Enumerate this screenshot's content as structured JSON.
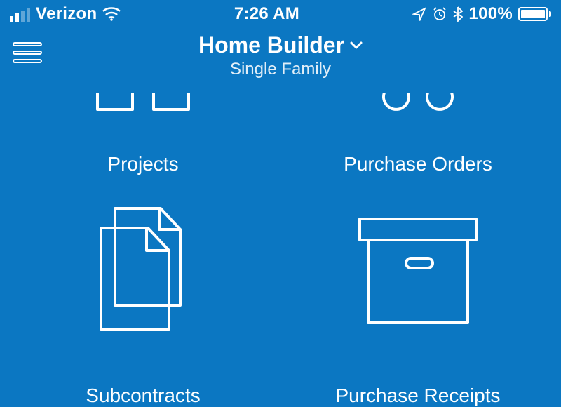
{
  "status": {
    "carrier": "Verizon",
    "time": "7:26 AM",
    "battery_pct": "100%",
    "battery_level": 100,
    "signal_bars": 2
  },
  "header": {
    "title": "Home Builder",
    "subtitle": "Single Family"
  },
  "tiles": {
    "projects": {
      "label": "Projects"
    },
    "purchase_orders": {
      "label": "Purchase Orders"
    },
    "subcontracts": {
      "label": "Subcontracts"
    },
    "purchase_receipts": {
      "label": "Purchase Receipts"
    }
  }
}
